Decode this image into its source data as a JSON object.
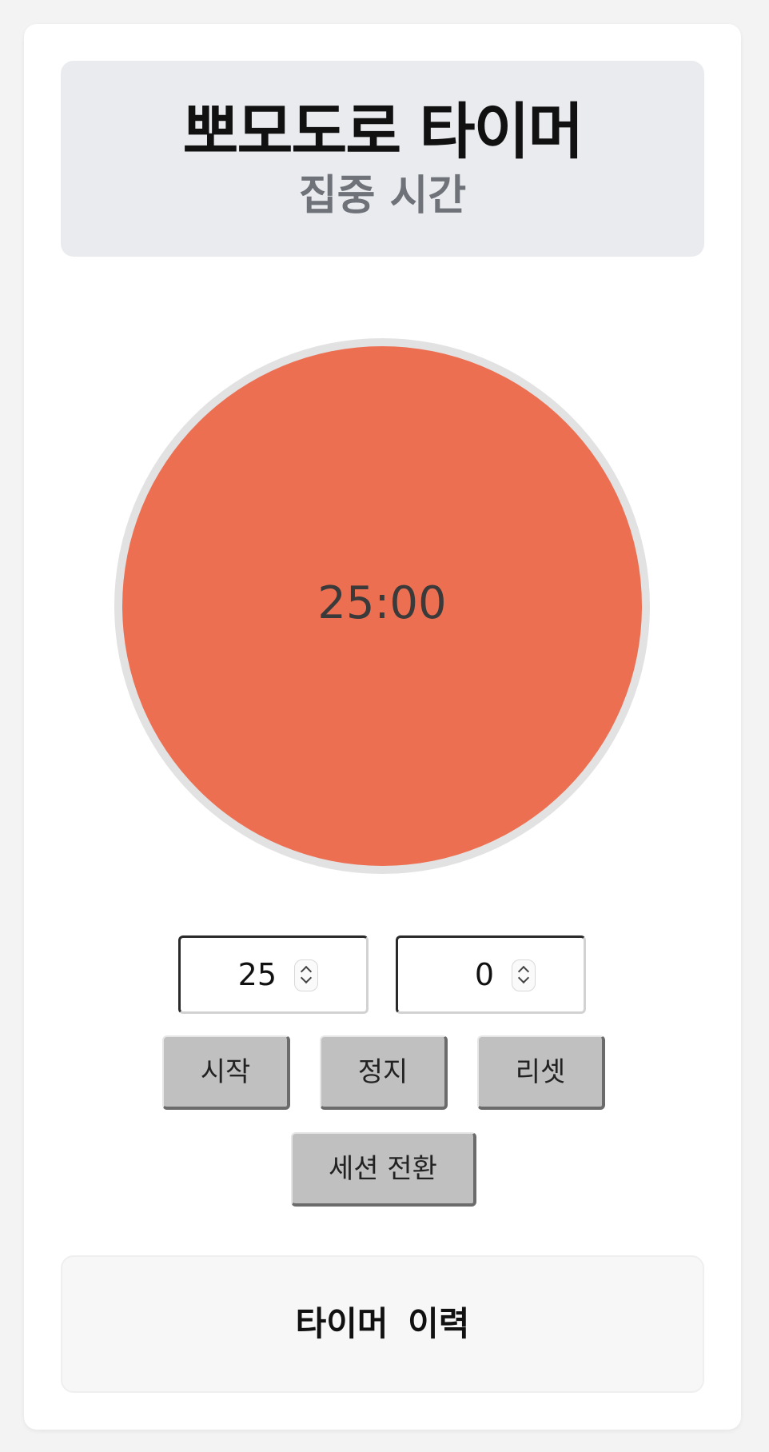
{
  "app": {
    "title": "뽀모도로 타이머",
    "session_label": "집중 시간"
  },
  "timer": {
    "display": "25:00",
    "dial_color": "#ec6f52"
  },
  "inputs": {
    "minutes_value": "25",
    "seconds_value": "0"
  },
  "controls": {
    "start_label": "시작",
    "stop_label": "정지",
    "reset_label": "리셋",
    "switch_session_label": "세션 전환"
  },
  "history": {
    "title": "타이머 이력"
  }
}
